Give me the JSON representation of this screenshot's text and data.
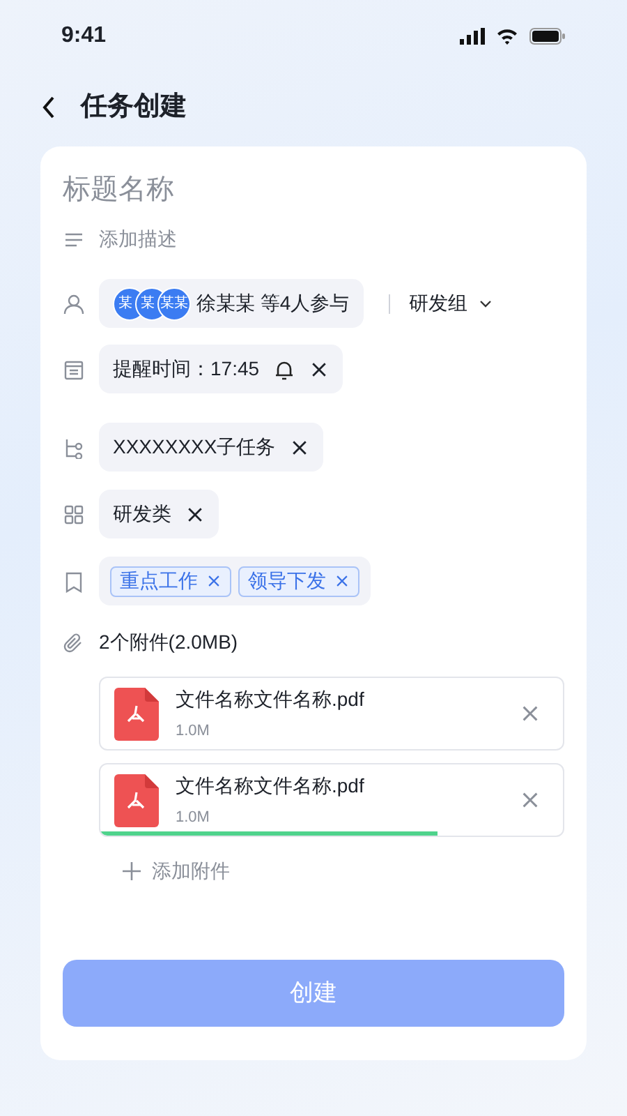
{
  "status_bar": {
    "time": "9:41"
  },
  "header": {
    "title": "任务创建"
  },
  "title_field": {
    "placeholder": "标题名称"
  },
  "description_field": {
    "placeholder": "添加描述"
  },
  "participants": {
    "avatars": [
      "某",
      "某",
      "某某"
    ],
    "text": "徐某某 等4人参与",
    "group": "研发组"
  },
  "reminder": {
    "text": "提醒时间：17:45"
  },
  "subtask": {
    "text": "XXXXXXXX子任务"
  },
  "category": {
    "text": "研发类"
  },
  "tags": [
    {
      "text": "重点工作"
    },
    {
      "text": "领导下发"
    }
  ],
  "attachments": {
    "summary": "2个附件(2.0MB)",
    "files": [
      {
        "name": "文件名称文件名称.pdf",
        "size": "1.0M"
      },
      {
        "name": "文件名称文件名称.pdf",
        "size": "1.0M",
        "level": 0.73
      }
    ],
    "add_label": "添加附件"
  },
  "submit": {
    "label": "创建",
    "disabled": true
  }
}
